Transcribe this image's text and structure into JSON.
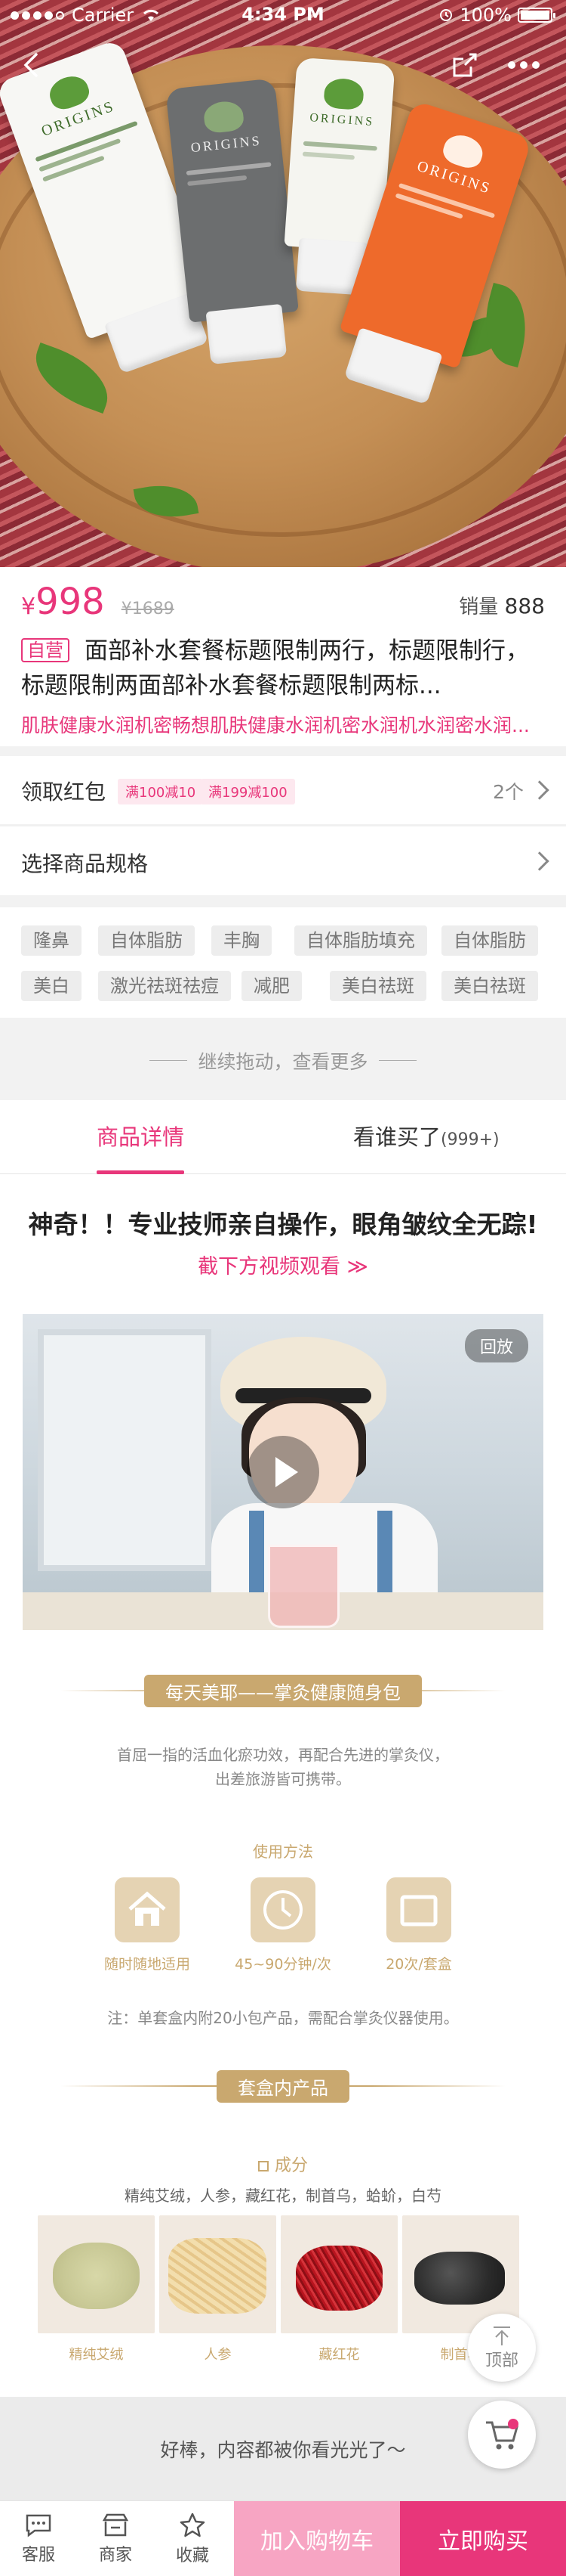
{
  "status_bar": {
    "carrier": "Carrier",
    "time": "4:34 PM",
    "battery": "100%",
    "battery_level": 1.0
  },
  "hero": {
    "tube_brand": "ORIGINS"
  },
  "product": {
    "currency": "¥",
    "price": "998",
    "original_price": "¥1689",
    "sales_label": "销量",
    "sales_count": "888",
    "tag": "自营",
    "title": "面部补水套餐标题限制两行，标题限制行，标题限制两面部补水套餐标题限制两标...",
    "subtitle": "肌肤健康水润机密畅想肌肤健康水润机密水润机水润密水润..."
  },
  "coupon_row": {
    "label": "领取红包",
    "coupons": [
      "满100减10",
      "满199减100"
    ],
    "count": "2个"
  },
  "spec_row": {
    "label": "选择商品规格"
  },
  "keywords": [
    "隆鼻",
    "自体脂肪",
    "丰胸",
    "自体脂肪填充",
    "自体脂肪",
    "美白",
    "激光祛斑祛痘",
    "减肥",
    "美白祛斑",
    "美白祛斑"
  ],
  "drag_more": "继续拖动，查看更多",
  "tabs": {
    "details": "商品详情",
    "buyers": "看谁买了",
    "buyers_count": "(999+)"
  },
  "detail": {
    "headline": "神奇！！专业技师亲自操作，眼角皱纹全无踪!",
    "subhead": "截下方视频观看 ≫",
    "video_replay": "回放",
    "banner1": "每天美耶——掌灸健康随身包",
    "intro_line1": "首屈一指的活血化瘀功效，再配合先进的掌灸仪，",
    "intro_line2": "出差旅游皆可携带。",
    "usage_title": "使用方法",
    "usage": [
      {
        "icon": "home-icon",
        "caption": "随时随地适用"
      },
      {
        "icon": "clock-icon",
        "caption": "45~90分钟/次"
      },
      {
        "icon": "box-icon",
        "caption": "20次/套盒"
      }
    ],
    "note": "注：单套盒内附20小包产品，需配合掌灸仪器使用。",
    "banner2": "套盒内产品",
    "ingredients_title": "成分",
    "ingredients_list": "精纯艾绒，人参，藏红花，制首乌，蛤蚧，白芍",
    "ingredients": [
      "精纯艾绒",
      "人参",
      "藏红花",
      "制首乌"
    ]
  },
  "float": {
    "top_label": "顶部"
  },
  "end_note": "好棒，内容都被你看光光了～",
  "bottom_bar": {
    "service": "客服",
    "shop": "商家",
    "favorite": "收藏",
    "add_cart": "加入购物车",
    "buy_now": "立即购买"
  },
  "colors": {
    "accent": "#e8367a",
    "accent_light": "#f7a5c3",
    "gold": "#c9a86f"
  }
}
